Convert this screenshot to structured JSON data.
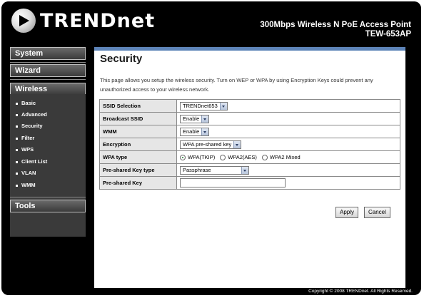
{
  "header": {
    "logo_text": "TRENDnet",
    "product_name": "300Mbps Wireless N PoE Access Point",
    "model": "TEW-653AP"
  },
  "sidebar": {
    "system": "System",
    "wizard": "Wizard",
    "wireless": "Wireless",
    "tools": "Tools",
    "submenu": [
      "Basic",
      "Advanced",
      "Security",
      "Filter",
      "WPS",
      "Client List",
      "VLAN",
      "WMM"
    ]
  },
  "page": {
    "title": "Security",
    "description": "This page allows you setup the wireless security. Turn on WEP or WPA by using Encryption Keys could prevent any unauthorized access to your wireless network."
  },
  "form": {
    "ssid_selection": {
      "label": "SSID Selection",
      "value": "TRENDnet653"
    },
    "broadcast_ssid": {
      "label": "Broadcast SSID",
      "value": "Enable"
    },
    "wmm": {
      "label": "WMM",
      "value": "Enable"
    },
    "encryption": {
      "label": "Encryption",
      "value": "WPA pre-shared key"
    },
    "wpa_type": {
      "label": "WPA type",
      "options": [
        "WPA(TKIP)",
        "WPA2(AES)",
        "WPA2 Mixed"
      ],
      "selected": "WPA(TKIP)"
    },
    "psk_type": {
      "label": "Pre-shared Key type",
      "value": "Passphrase"
    },
    "psk": {
      "label": "Pre-shared Key",
      "value": ""
    }
  },
  "buttons": {
    "apply": "Apply",
    "cancel": "Cancel"
  },
  "footer": "Copyright © 2008 TRENDnet. All Rights Reserved.",
  "colors": {
    "accent_bar": "#5d84b8",
    "label_bg": "#e6e6e6",
    "frame": "#000000"
  }
}
